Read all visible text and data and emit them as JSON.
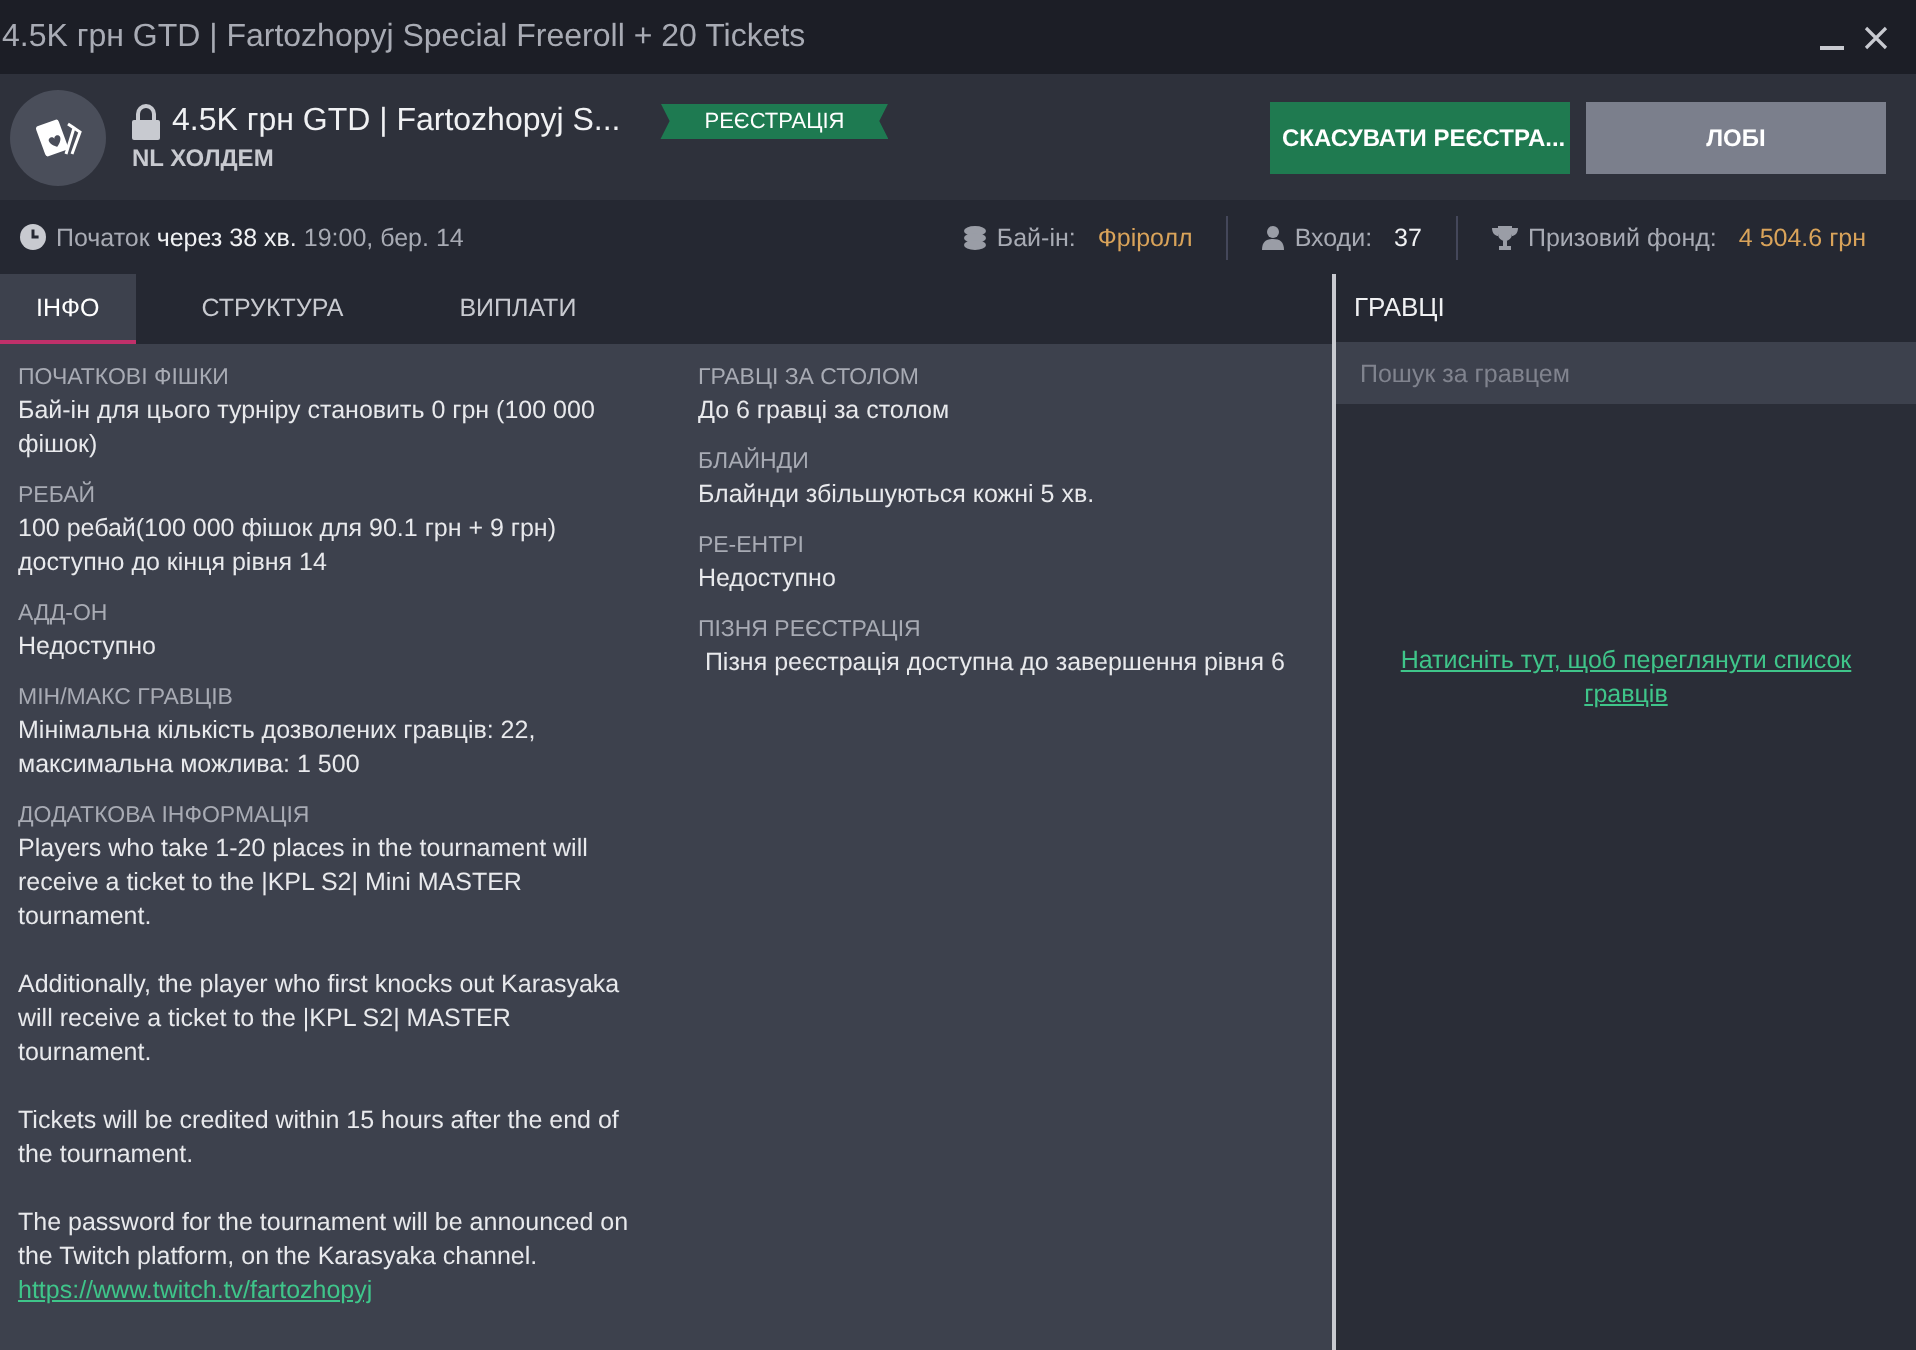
{
  "window": {
    "title": "4.5K грн GTD | Fartozhopyj Special Freeroll + 20 Tickets"
  },
  "header": {
    "title": "4.5K грн GTD | Fartozhopyj S...",
    "locked": true,
    "game": "NL ХОЛДЕМ",
    "status": "РЕЄСТРАЦІЯ",
    "buttons": [
      {
        "label": "СКАСУВАТИ РЕЄСТРА...",
        "kind": "primary"
      },
      {
        "label": "ЛОБІ",
        "kind": "secondary"
      }
    ]
  },
  "info_bar": {
    "start": "Початок **через 38 хв.** 19:00, бер. 14",
    "buyin_label": "Бай-ін:",
    "buyin_value": "Фріролл",
    "entries_label": "Входи:",
    "entries_value": "37",
    "prize_label": "Призовий фонд:",
    "prize_value": "4 504.6 грн"
  },
  "tabs": [
    {
      "label": "ІНФО",
      "selected": true
    },
    {
      "label": "СТРУКТУРА",
      "selected": false
    },
    {
      "label": "ВИПЛАТИ",
      "selected": false
    }
  ],
  "details_left": [
    {
      "heading": "ПОЧАТКОВІ ФІШКИ",
      "paragraphs": [
        "Бай-ін для цього турніру становить 0 грн (100 000 фішок)"
      ]
    },
    {
      "heading": "РЕБАЙ",
      "paragraphs": [
        "100 ребай(100 000 фішок для 90.1 грн + 9 грн) доступно до кінця рівня 14"
      ]
    },
    {
      "heading": "АДД-ОН",
      "paragraphs": [
        "Недоступно"
      ]
    },
    {
      "heading": "МІН/МАКС ГРАВЦІВ",
      "paragraphs": [
        "Мінімальна кількість дозволених гравців: 22, максимальна можлива: 1 500"
      ]
    },
    {
      "heading": "ДОДАТКОВА ІНФОРМАЦІЯ",
      "paragraphs": [
        "Players who take 1-20 places in the tournament will receive a ticket to the |KPL S2| Mini MASTER tournament.",
        "Additionally, the player who first knocks out Karasyaka will receive a ticket to the |KPL S2| MASTER tournament.",
        "Tickets will be credited within 15 hours after the end of the tournament.",
        "The password for the tournament will be announced on the Twitch platform, on the Karasyaka channel."
      ],
      "link": "https://www.twitch.tv/fartozhopyj"
    }
  ],
  "details_right": [
    {
      "heading": "ГРАВЦІ ЗА СТОЛОМ",
      "paragraphs": [
        "До 6 гравці за столом"
      ]
    },
    {
      "heading": "БЛАЙНДИ",
      "paragraphs": [
        "Блайнди збільшуються кожні 5 хв."
      ]
    },
    {
      "heading": "РЕ-ЕНТРІ",
      "paragraphs": [
        "Недоступно"
      ]
    },
    {
      "heading": "ПІЗНЯ РЕЄСТРАЦІЯ",
      "paragraphs": [
        " Пізня реєстрація доступна до завершення рівня 6"
      ]
    }
  ],
  "players": {
    "title": "ГРАВЦІ",
    "search_placeholder": "Пошук за гравцем",
    "link": "Натисніть тут, щоб переглянути список гравців"
  }
}
